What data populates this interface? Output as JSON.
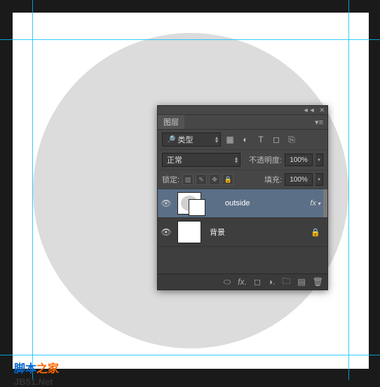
{
  "panel": {
    "title": "图层",
    "filter_label": "类型",
    "blend_mode": "正常",
    "opacity_label": "不透明度:",
    "opacity_value": "100%",
    "lock_label": "锁定:",
    "fill_label": "填充:",
    "fill_value": "100%",
    "fx_label": "fx"
  },
  "layers": [
    {
      "name": "outside",
      "selected": true,
      "has_fx": true,
      "locked": false
    },
    {
      "name": "背景",
      "selected": false,
      "has_fx": false,
      "locked": true
    }
  ],
  "watermark": {
    "part1": "脚本",
    "part2": "之家",
    "url": "JB51.Net"
  }
}
